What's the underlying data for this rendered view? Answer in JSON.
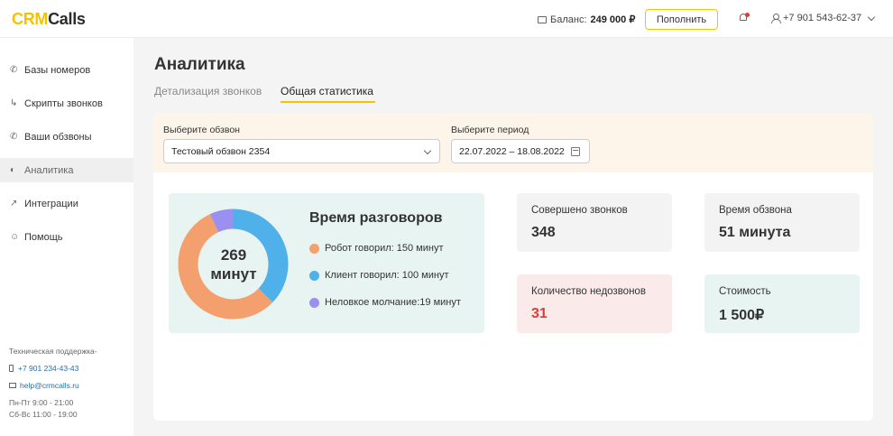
{
  "header": {
    "logo_part1": "CRM",
    "logo_part2": "Calls",
    "balance_label": "Баланс:",
    "balance_value": "249 000 ₽",
    "topup_button": "Пополнить",
    "user_phone": "+7 901 543-62-37"
  },
  "sidebar": {
    "items": [
      {
        "label": "Базы номеров",
        "icon": "phone-plus-icon"
      },
      {
        "label": "Скрипты звонков",
        "icon": "script-icon"
      },
      {
        "label": "Ваши обзвоны",
        "icon": "phone-outgoing-icon"
      },
      {
        "label": "Аналитика",
        "icon": "analytics-icon",
        "active": true
      },
      {
        "label": "Интеграции",
        "icon": "integrations-icon"
      },
      {
        "label": "Помощь",
        "icon": "help-icon"
      }
    ],
    "support": {
      "title": "Техническая поддержка-",
      "phone": "+7 901 234-43-43",
      "email": "help@crmcalls.ru",
      "hours_weekdays": "Пн-Пт 9:00 - 21:00",
      "hours_weekend": "Сб-Вс 11:00 - 19:00"
    }
  },
  "main": {
    "title": "Аналитика",
    "tabs": [
      {
        "label": "Детализация звонков",
        "active": false
      },
      {
        "label": "Общая статистика",
        "active": true
      }
    ],
    "filters": {
      "campaign_label": "Выберите обзвон",
      "campaign_value": "Тестовый обзвон 2354",
      "period_label": "Выберите период",
      "period_value": "22.07.2022 – 18.08.2022"
    },
    "talk_time": {
      "title": "Время разговоров",
      "total_value": "269",
      "total_unit": "минут",
      "legend": [
        {
          "label": "Робот говорил: 150 минут",
          "color": "#f4a06e",
          "minutes": 150
        },
        {
          "label": "Клиент говорил: 100 минут",
          "color": "#4fb0ea",
          "minutes": 100
        },
        {
          "label": "Неловкое молчание:19 минут",
          "color": "#9b8ff2",
          "minutes": 19
        }
      ]
    },
    "stats": [
      {
        "label": "Совершено звонков",
        "value": "348",
        "bg": "#f3f3f3",
        "color": "#333333"
      },
      {
        "label": "Время обзвона",
        "value": "51 минута",
        "bg": "#f3f3f3",
        "color": "#333333"
      },
      {
        "label": "Количество недозвонов",
        "value": "31",
        "bg": "#fbeaea",
        "color": "#e53935"
      },
      {
        "label": "Стоимость",
        "value": "1 500₽",
        "bg": "#e8f4f1",
        "color": "#333333"
      }
    ]
  }
}
